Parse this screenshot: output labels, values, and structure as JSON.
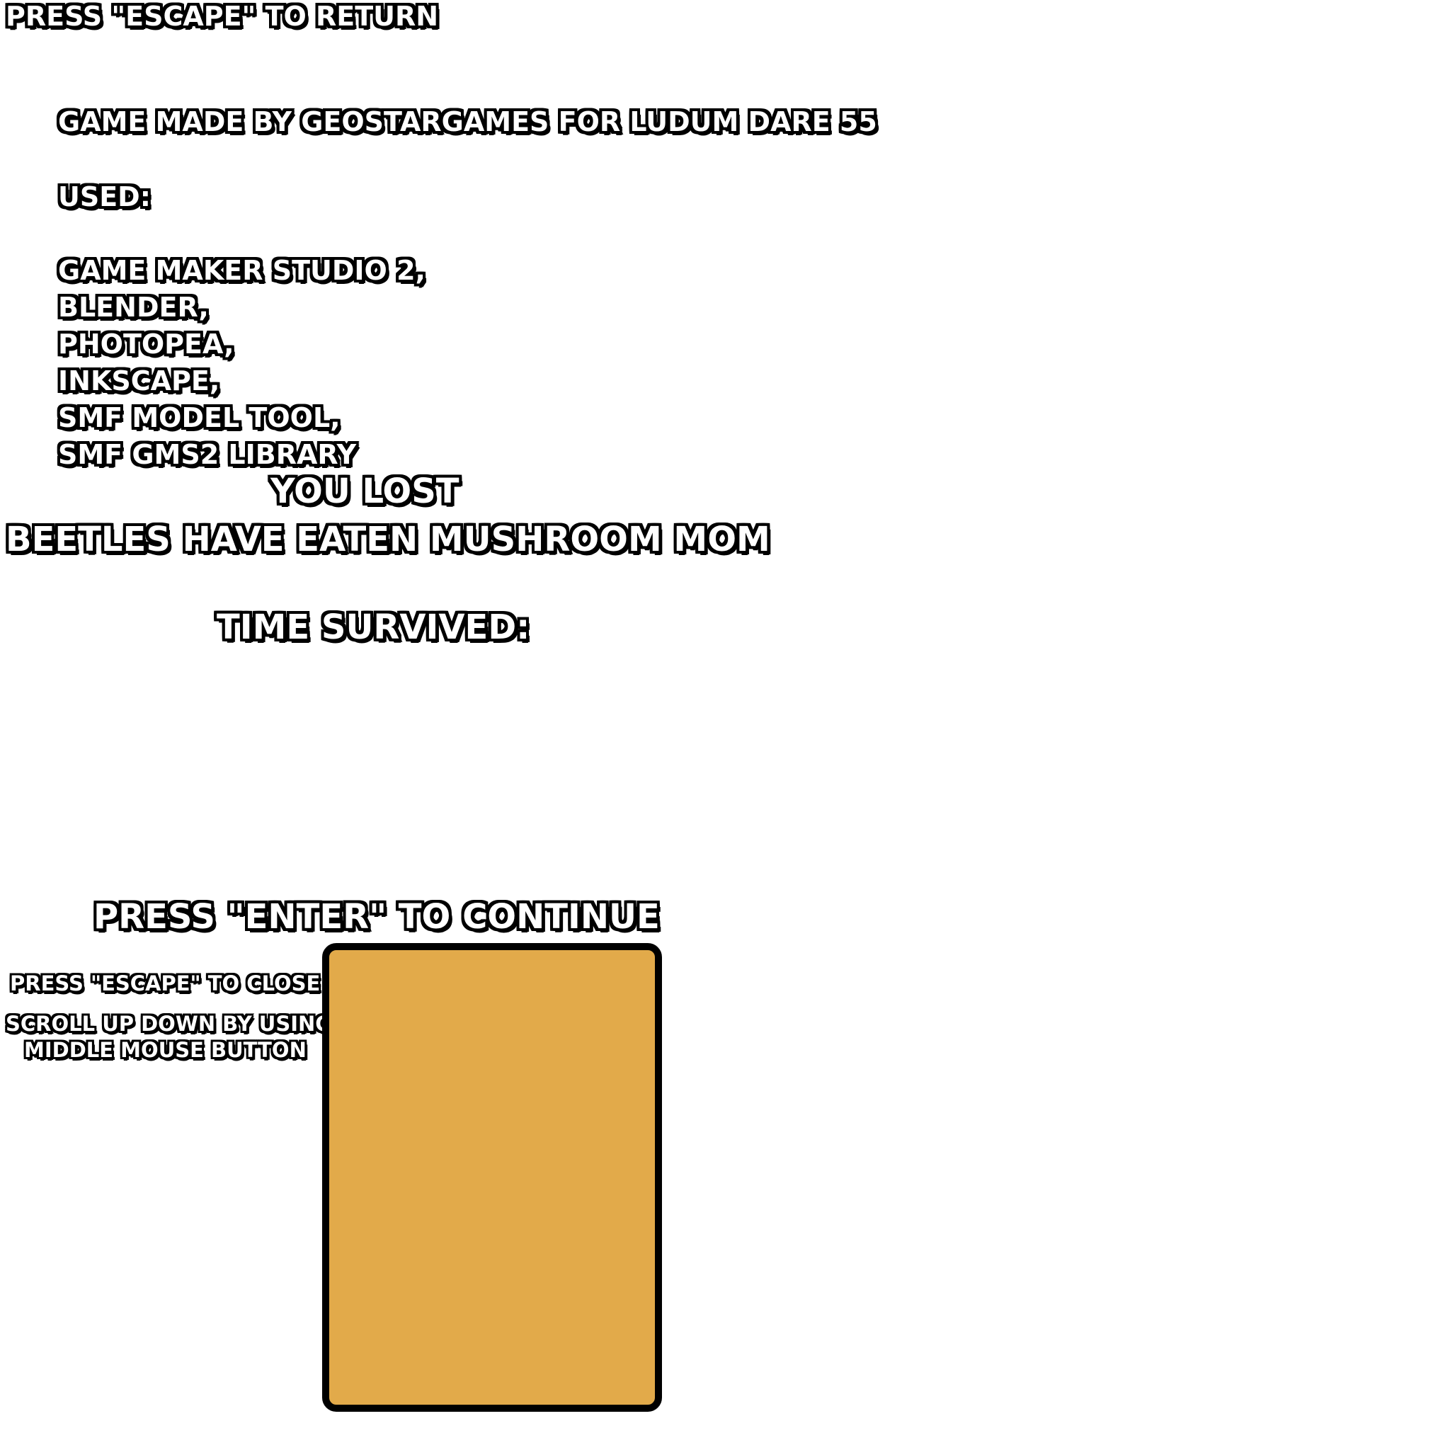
{
  "colors": {
    "background": "#ffffff",
    "text_fill": "#ffffff",
    "text_outline": "#000000",
    "panel_fill": "#e2aa4a",
    "panel_border": "#000000"
  },
  "credits": {
    "escape_hint": "PRESS \"ESCAPE\" TO RETURN",
    "title": "GAME MADE BY GEOSTARGAMES FOR LUDUM DARE 55",
    "used_label": "USED:",
    "tools": [
      "GAME MAKER STUDIO 2,",
      "BLENDER,",
      "PHOTOPEA,",
      "INKSCAPE,",
      "SMF MODEL TOOL,",
      "SMF GMS2 LIBRARY"
    ]
  },
  "game_over": {
    "heading": "YOU LOST",
    "reason": "BEETLES HAVE EATEN MUSHROOM MOM",
    "time_label": "TIME SURVIVED:",
    "continue_hint": "PRESS \"ENTER\" TO CONTINUE"
  },
  "panel_hints": {
    "close": "PRESS \"ESCAPE\" TO CLOSE",
    "scroll_line1": "SCROLL UP DOWN BY USING",
    "scroll_line2": "MIDDLE MOUSE BUTTON"
  }
}
